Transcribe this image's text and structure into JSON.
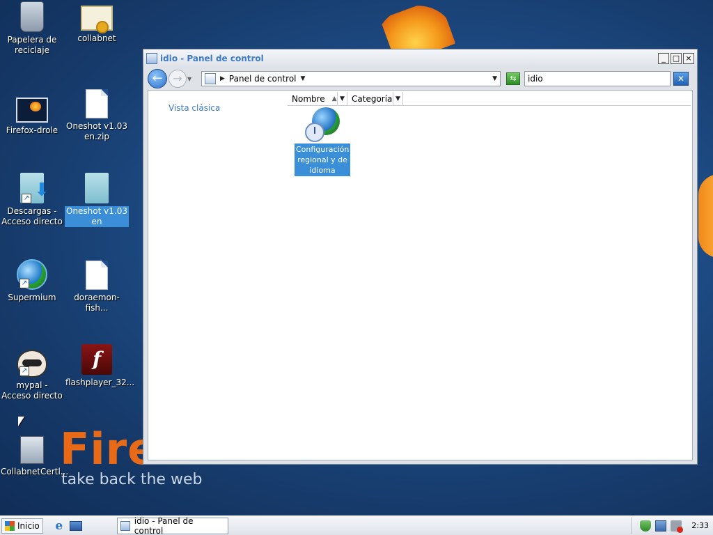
{
  "desktop": {
    "brand": {
      "word": "Firef",
      "tagline": "take back the web"
    },
    "icons": [
      {
        "label": "Papelera de reciclaje"
      },
      {
        "label": "collabnet"
      },
      {
        "label": "Firefox-drole"
      },
      {
        "label": "Oneshot v1.03 en.zip"
      },
      {
        "label": "Descargas - Acceso directo"
      },
      {
        "label": "Oneshot v1.03 en"
      },
      {
        "label": "Supermium"
      },
      {
        "label": "doraemon-fish..."
      },
      {
        "label": "mypal - Acceso directo"
      },
      {
        "label": "flashplayer_32..."
      },
      {
        "label": "CollabnetCertl..."
      }
    ]
  },
  "window": {
    "title": "idio - Panel de control",
    "buttons": {
      "minimize": "_",
      "maximize": "□",
      "close": "×"
    },
    "nav": {
      "back_glyph": "←",
      "forward_glyph": "→",
      "address_sep": "▶",
      "address": "Panel de control",
      "search_value": "idio",
      "clear_glyph": "✕",
      "go_glyph": "⇆"
    },
    "left_pane": {
      "classic_view": "Vista clásica"
    },
    "columns": [
      {
        "label": "Nombre",
        "sort": "▲"
      },
      {
        "label": "Categoría"
      }
    ],
    "items": [
      {
        "label": "Configuración regional y de idioma"
      }
    ]
  },
  "taskbar": {
    "start_label": "Inicio",
    "ie_glyph": "e",
    "task_label": "idio - Panel de control",
    "clock": "2:33"
  },
  "colors": {
    "selection": "#3b8ed8",
    "title_text": "#3d7bc7",
    "link": "#3a79c4"
  }
}
